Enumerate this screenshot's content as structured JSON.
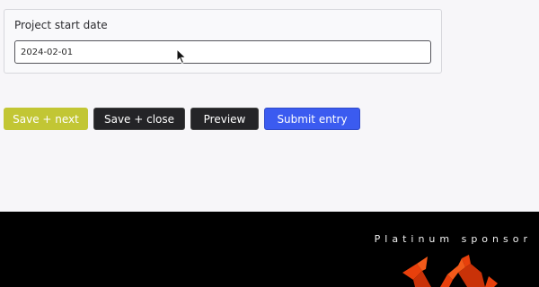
{
  "form": {
    "field_label": "Project start date",
    "field_value": "2024-02-01"
  },
  "actions": {
    "save_next": "Save + next",
    "save_close": "Save + close",
    "preview": "Preview",
    "submit": "Submit entry"
  },
  "footer": {
    "sponsor_label": "Platinum sponsor",
    "logo_colors": [
      "#e8400c",
      "#f25a1a",
      "#c93208"
    ]
  },
  "colors": {
    "primary_accent": "#3b5bf0",
    "secondary_accent": "#c2c634",
    "dark_button": "#242427"
  }
}
